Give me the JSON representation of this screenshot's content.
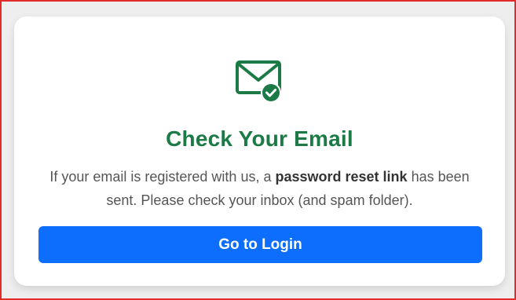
{
  "card": {
    "icon": "email-check-icon",
    "title": "Check Your Email",
    "message": {
      "part1": "If your email is registered with us, a ",
      "bold": "password reset link",
      "part2": " has been sent. Please check your inbox (and spam folder)."
    },
    "button_label": "Go to Login"
  },
  "colors": {
    "success_green": "#1b7a45",
    "primary_blue": "#0d6efd",
    "frame_red": "#e32b2b"
  }
}
